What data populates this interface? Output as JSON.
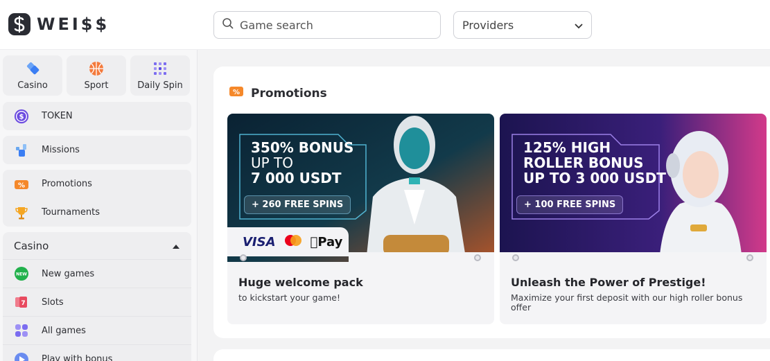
{
  "header": {
    "logo_text": "WEI$$",
    "search_placeholder": "Game search",
    "providers_label": "Providers"
  },
  "sidebar": {
    "tiles": [
      {
        "label": "Casino",
        "icon": "diamond-icon"
      },
      {
        "label": "Sport",
        "icon": "basketball-icon"
      },
      {
        "label": "Daily Spin",
        "icon": "grid-icon"
      }
    ],
    "token": {
      "label": "TOKEN",
      "icon": "token-coin-icon"
    },
    "missions": {
      "label": "Missions",
      "icon": "missions-icon"
    },
    "promotions": {
      "label": "Promotions",
      "icon": "ticket-icon"
    },
    "tournaments": {
      "label": "Tournaments",
      "icon": "trophy-icon"
    },
    "casino_group": {
      "title": "Casino",
      "items": [
        {
          "label": "New games",
          "icon": "new-badge-icon"
        },
        {
          "label": "Slots",
          "icon": "slots-icon"
        },
        {
          "label": "All games",
          "icon": "all-games-icon"
        },
        {
          "label": "Play with bonus",
          "icon": "play-icon"
        }
      ]
    }
  },
  "main": {
    "section_title": "Promotions",
    "promos": [
      {
        "banner_line1": "350% BONUS",
        "banner_line2": "UP TO",
        "banner_line3": "7 000 USDT",
        "spins": "+ 260 FREE SPINS",
        "title": "Huge welcome pack",
        "desc": "to kickstart your game!",
        "payments": [
          "VISA",
          "Pay"
        ]
      },
      {
        "banner_line1": "125% HIGH",
        "banner_line2": "ROLLER BONUS",
        "banner_line3": "UP TO 3 000 USDT",
        "spins": "+ 100 FREE SPINS",
        "title": "Unleash the Power of Prestige!",
        "desc": "Maximize your first deposit with our high roller bonus offer"
      }
    ]
  },
  "colors": {
    "accent_orange": "#f5882a",
    "token_purple": "#6c4ce0",
    "banner1_bg": "#0d2b3a",
    "banner2_bg": "#2a1a6a"
  }
}
